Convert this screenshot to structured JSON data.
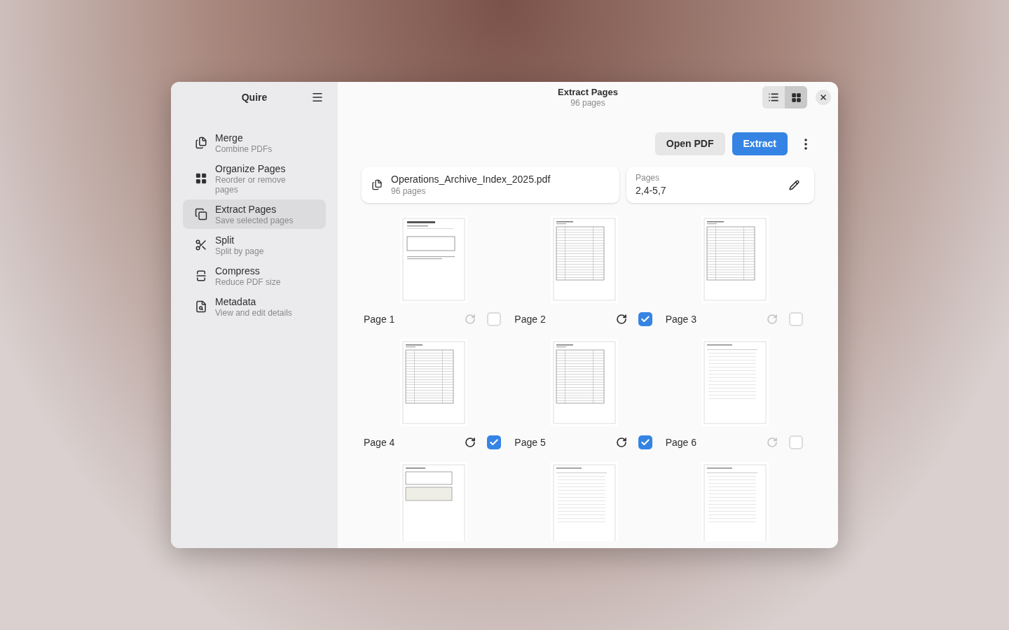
{
  "sidebar": {
    "title": "Quire",
    "items": [
      {
        "kind": "merge",
        "label": "Merge",
        "sublabel": "Combine PDFs",
        "selected": false
      },
      {
        "kind": "organize",
        "label": "Organize Pages",
        "sublabel": "Reorder or remove pages",
        "selected": false
      },
      {
        "kind": "extract",
        "label": "Extract Pages",
        "sublabel": "Save selected pages",
        "selected": true
      },
      {
        "kind": "split",
        "label": "Split",
        "sublabel": "Split by page",
        "selected": false
      },
      {
        "kind": "compress",
        "label": "Compress",
        "sublabel": "Reduce PDF size",
        "selected": false
      },
      {
        "kind": "metadata",
        "label": "Metadata",
        "sublabel": "View and edit details",
        "selected": false
      }
    ]
  },
  "header": {
    "title": "Extract Pages",
    "subtitle": "96 pages",
    "view_modes": [
      {
        "kind": "list",
        "selected": false
      },
      {
        "kind": "grid",
        "selected": true
      }
    ]
  },
  "toolbar": {
    "buttons": [
      {
        "kind": "secondary",
        "label": "Open PDF"
      },
      {
        "kind": "primary",
        "label": "Extract"
      }
    ]
  },
  "file": {
    "name": "Operations_Archive_Index_2025.pdf",
    "pages": "96 pages"
  },
  "range": {
    "label": "Pages",
    "value": "2,4-5,7"
  },
  "pages": [
    {
      "kind": "cover",
      "label": "Page 1",
      "selected": false
    },
    {
      "kind": "table",
      "label": "Page 2",
      "selected": true
    },
    {
      "kind": "table",
      "label": "Page 3",
      "selected": false
    },
    {
      "kind": "table",
      "label": "Page 4",
      "selected": true
    },
    {
      "kind": "table",
      "label": "Page 5",
      "selected": true
    },
    {
      "kind": "lines",
      "label": "Page 6",
      "selected": false
    },
    {
      "kind": "form"
    },
    {
      "kind": "lines"
    },
    {
      "kind": "lines"
    }
  ]
}
